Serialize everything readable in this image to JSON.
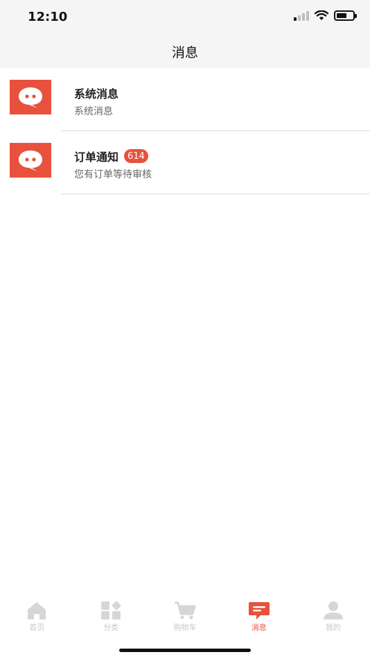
{
  "status_bar": {
    "time": "12:10"
  },
  "header": {
    "title": "消息"
  },
  "messages": [
    {
      "title": "系统消息",
      "subtitle": "系统消息",
      "badge": ""
    },
    {
      "title": "订单通知",
      "subtitle": "您有订单等待审核",
      "badge": "614"
    }
  ],
  "tabs": [
    {
      "label": "首页",
      "icon": "home-icon",
      "active": false
    },
    {
      "label": "分类",
      "icon": "category-icon",
      "active": false
    },
    {
      "label": "购物车",
      "icon": "cart-icon",
      "active": false
    },
    {
      "label": "消息",
      "icon": "message-icon",
      "active": true
    },
    {
      "label": "我的",
      "icon": "user-icon",
      "active": false
    }
  ],
  "colors": {
    "accent": "#e8513d",
    "inactive": "#c8c8c8",
    "header_bg": "#f5f5f5"
  }
}
